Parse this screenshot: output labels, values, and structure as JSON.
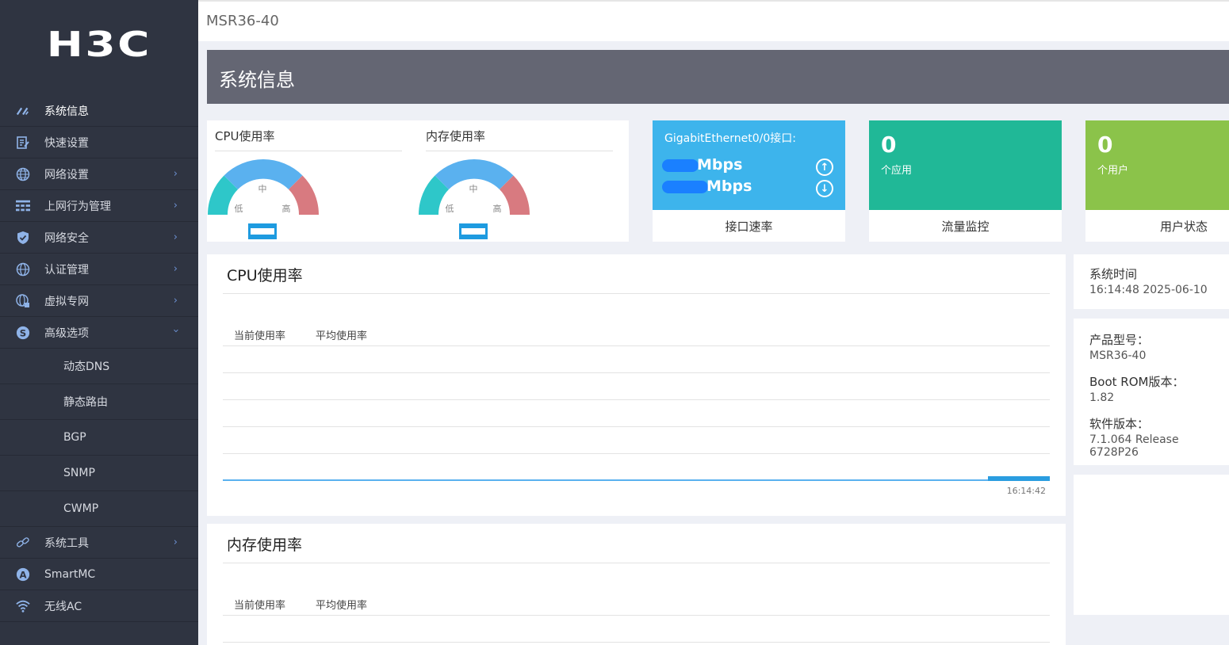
{
  "brand": {
    "logo": "H3C"
  },
  "topbar": {
    "device_name": "MSR36-40"
  },
  "sidebar": {
    "items": [
      {
        "label": "系统信息",
        "icon": "speedometer-icon",
        "active": true,
        "has_arrow": false
      },
      {
        "label": "快速设置",
        "icon": "edit-document-icon",
        "has_arrow": false
      },
      {
        "label": "网络设置",
        "icon": "globe-icon",
        "has_arrow": true
      },
      {
        "label": "上网行为管理",
        "icon": "grid-icon",
        "has_arrow": true
      },
      {
        "label": "网络安全",
        "icon": "shield-icon",
        "has_arrow": true
      },
      {
        "label": "认证管理",
        "icon": "globe-icon",
        "has_arrow": true
      },
      {
        "label": "虚拟专网",
        "icon": "globe-lock-icon",
        "has_arrow": true
      },
      {
        "label": "高级选项",
        "icon": "s-circle-icon",
        "has_arrow": true,
        "expanded": true
      }
    ],
    "sub_items": [
      "动态DNS",
      "静态路由",
      "BGP",
      "SNMP",
      "CWMP"
    ],
    "bottom_items": [
      {
        "label": "系统工具",
        "icon": "link-icon",
        "has_arrow": true
      },
      {
        "label": "SmartMC",
        "icon": "a-circle-icon",
        "has_arrow": false
      },
      {
        "label": "无线AC",
        "icon": "wifi-icon",
        "has_arrow": false
      }
    ]
  },
  "page": {
    "title": "系统信息"
  },
  "gauges": {
    "cpu": {
      "title": "CPU使用率",
      "low": "低",
      "mid": "中",
      "high": "高"
    },
    "mem": {
      "title": "内存使用率",
      "low": "低",
      "mid": "中",
      "high": "高"
    }
  },
  "interface_card": {
    "title": "GigabitEthernet0/0接口:",
    "up_unit": "Mbps",
    "down_unit": "Mbps",
    "footer": "接口速率",
    "color": "#3db4ec"
  },
  "apps_card": {
    "count": "0",
    "label": "个应用",
    "footer": "流量监控",
    "color": "#20b897"
  },
  "users_card": {
    "count": "0",
    "label": "个用户",
    "footer": "用户状态",
    "color": "#8bc34a"
  },
  "cpu_chart": {
    "title": "CPU使用率",
    "legend_current": "当前使用率",
    "legend_average": "平均使用率",
    "time_label": "16:14:42"
  },
  "mem_chart": {
    "title": "内存使用率",
    "legend_current": "当前使用率",
    "legend_average": "平均使用率"
  },
  "system_time": {
    "label": "系统时间",
    "value": "16:14:48  2025-06-10"
  },
  "product": {
    "model_label": "产品型号：",
    "model_value": "MSR36-40",
    "boot_label": "Boot ROM版本：",
    "boot_value": "1.82",
    "software_label": "软件版本：",
    "software_value": "7.1.064 Release 6728P26"
  }
}
